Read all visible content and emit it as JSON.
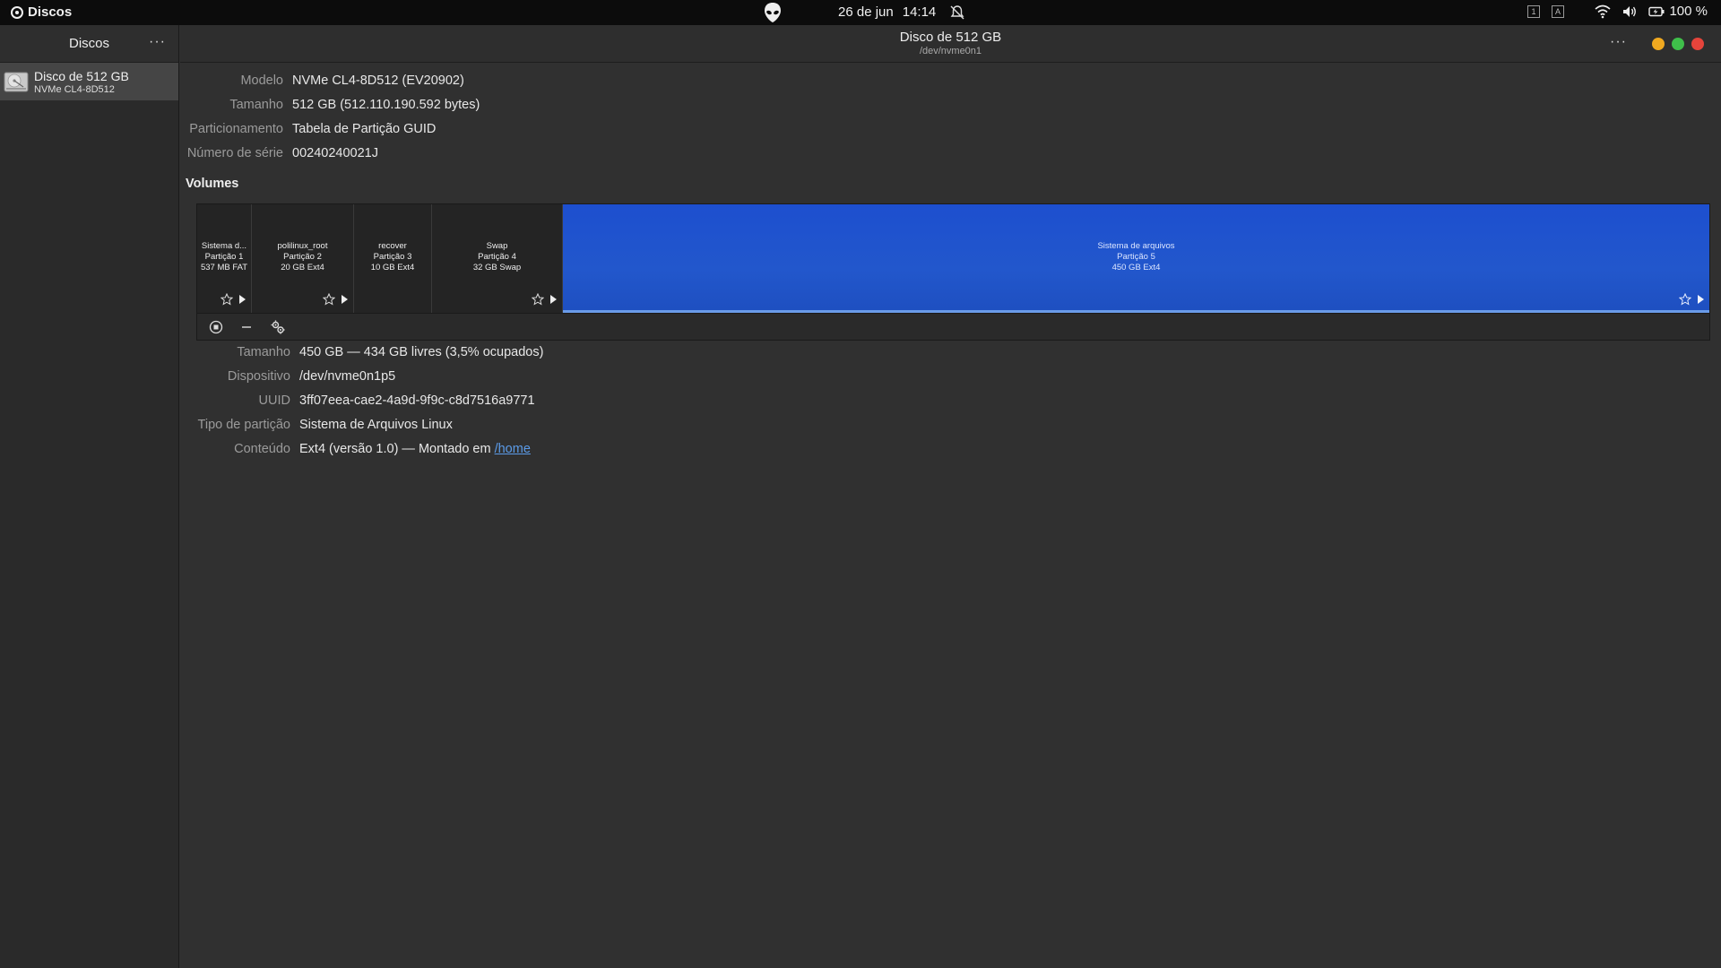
{
  "topbar": {
    "app_name": "Discos",
    "date": "26 de jun",
    "time": "14:14",
    "workspace_1": "1",
    "workspace_2": "A",
    "battery": "100 %"
  },
  "sidebar": {
    "title": "Discos",
    "menu": "···",
    "items": [
      {
        "name": "Disco de 512 GB",
        "model": "NVMe CL4-8D512"
      }
    ]
  },
  "header": {
    "title": "Disco de 512 GB",
    "subtitle": "/dev/nvme0n1",
    "menu": "···"
  },
  "drive_info": {
    "model_label": "Modelo",
    "model": "NVMe CL4-8D512 (EV20902)",
    "size_label": "Tamanho",
    "size": "512 GB (512.110.190.592 bytes)",
    "partitioning_label": "Particionamento",
    "partitioning": "Tabela de Partição GUID",
    "serial_label": "Número de série",
    "serial": "00240240021J"
  },
  "volumes_label": "Volumes",
  "partitions": [
    {
      "name": "Sistema d...",
      "part": "Partição 1",
      "info": "537 MB FAT"
    },
    {
      "name": "polilinux_root",
      "part": "Partição 2",
      "info": "20 GB Ext4"
    },
    {
      "name": "recover",
      "part": "Partição 3",
      "info": "10 GB Ext4"
    },
    {
      "name": "Swap",
      "part": "Partição 4",
      "info": "32 GB Swap"
    },
    {
      "name": "Sistema de arquivos",
      "part": "Partição 5",
      "info": "450 GB Ext4"
    }
  ],
  "volume_info": {
    "size_label": "Tamanho",
    "size": "450 GB — 434 GB livres (3,5% ocupados)",
    "device_label": "Dispositivo",
    "device": "/dev/nvme0n1p5",
    "uuid_label": "UUID",
    "uuid": "3ff07eea-cae2-4a9d-9f9c-c8d7516a9771",
    "type_label": "Tipo de partição",
    "type": "Sistema de Arquivos Linux",
    "content_label": "Conteúdo",
    "content": "Ext4 (versão 1.0) — Montado em ",
    "mount": "/home"
  },
  "colors": {
    "window_close": "#e5443b",
    "window_max": "#3fbf4a",
    "window_min": "#f0a920",
    "selected_partition": "#2257cc",
    "link": "#5b9be8"
  }
}
